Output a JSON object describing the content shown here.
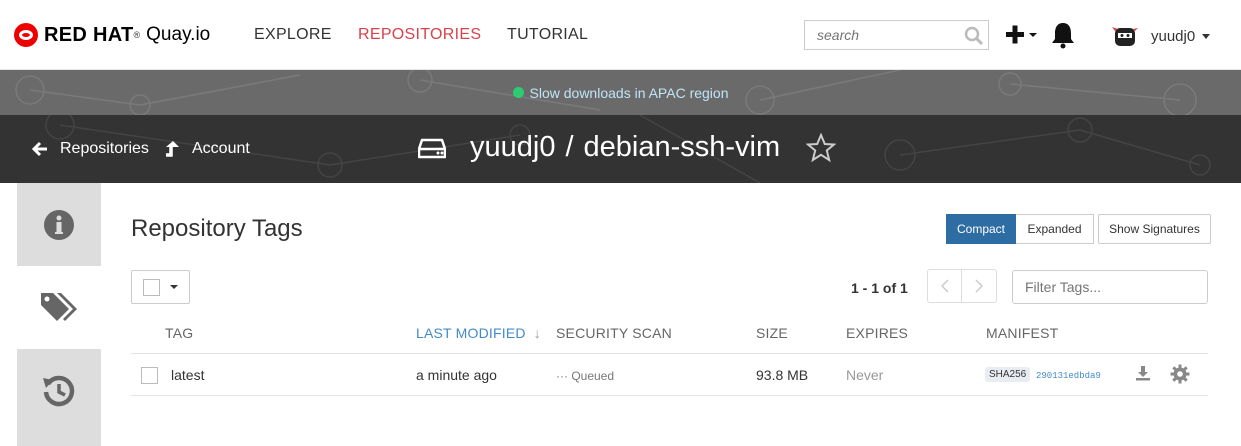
{
  "brand": {
    "company": "RED HAT",
    "registered": "®",
    "product": "Quay.io"
  },
  "nav": {
    "explore": "EXPLORE",
    "repositories": "REPOSITORIES",
    "tutorial": "TUTORIAL"
  },
  "search": {
    "placeholder": "search"
  },
  "user": {
    "name": "yuudj0"
  },
  "alert": {
    "text": "Slow downloads in APAC region",
    "status_color": "#2ecc71"
  },
  "header": {
    "back_label": "Repositories",
    "account_label": "Account",
    "namespace": "yuudj0",
    "separator": "/",
    "repo": "debian-ssh-vim"
  },
  "sidebar": {
    "tabs": [
      "info-icon",
      "tags-icon",
      "history-icon"
    ],
    "active": 1
  },
  "tags": {
    "title": "Repository Tags",
    "view_buttons": {
      "compact": "Compact",
      "expanded": "Expanded",
      "signatures": "Show Signatures"
    },
    "paging": "1 - 1 of 1",
    "filter_placeholder": "Filter Tags...",
    "columns": {
      "tag": "TAG",
      "last_modified": "LAST MODIFIED",
      "security": "SECURITY SCAN",
      "size": "SIZE",
      "expires": "EXPIRES",
      "manifest": "MANIFEST"
    },
    "rows": [
      {
        "tag": "latest",
        "modified": "a minute ago",
        "scan": "Queued",
        "size": "93.8 MB",
        "expires": "Never",
        "digest_type": "SHA256",
        "digest": "290131edbda9"
      }
    ]
  },
  "colors": {
    "accent": "#2e6da4",
    "nav_active": "#d9414b",
    "link": "#428bca"
  }
}
